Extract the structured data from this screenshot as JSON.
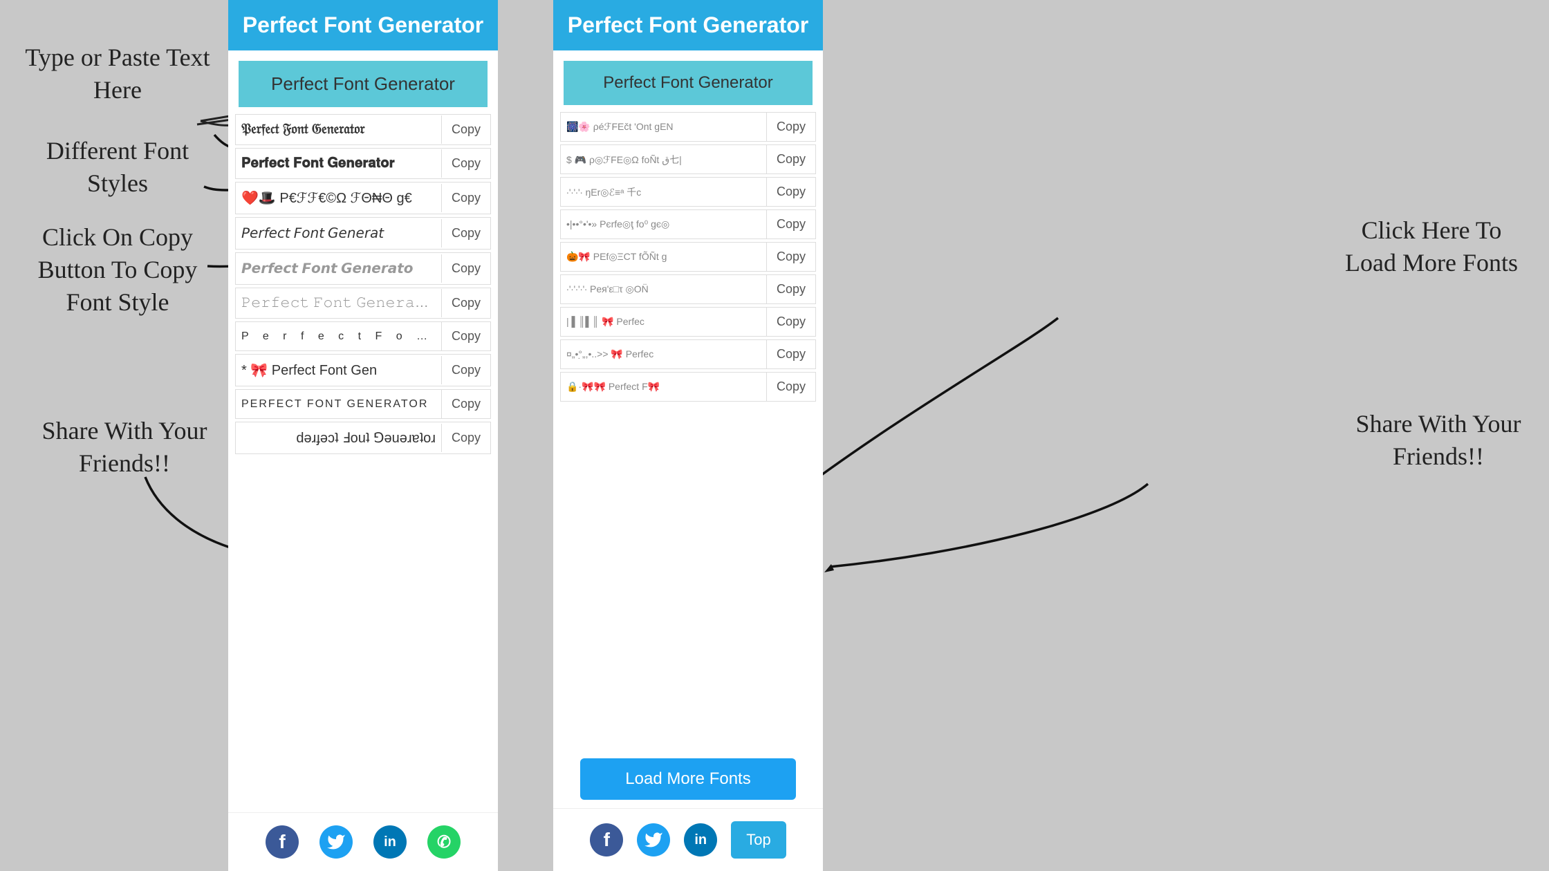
{
  "app": {
    "title": "Perfect Font Generator",
    "background_color": "#c8c8c8"
  },
  "annotations": {
    "type_paste": "Type or Paste Text\nHere",
    "different_fonts": "Different Font\nStyles",
    "click_copy": "Click On Copy\nButton To Copy\nFont Style",
    "share_left": "Share With\nYour\nFriends!!",
    "click_load": "Click Here To\nLoad More\nFonts",
    "share_right": "Share With\nYour\nFriends!!"
  },
  "left_panel": {
    "header": "Perfect Font Generator",
    "input_placeholder": "Perfect Font Generator",
    "fonts": [
      {
        "text": "𝔓𝔢𝔯𝔣𝔢𝔠𝔱 𝔉𝔬𝔫𝔱 𝔊𝔢𝔫𝔢𝔯𝔞𝔱𝔬𝔯",
        "style": "gothic",
        "copy_label": "Copy"
      },
      {
        "text": "𝐏𝐞𝐫𝐟𝐞𝐜𝐭 𝐅𝐨𝐧𝐭 𝐆𝐞𝐧𝐞𝐫𝐚𝐭𝐨𝐫",
        "style": "bold",
        "copy_label": "Copy"
      },
      {
        "text": "❤️🎩 Ρ€ℱℱ€©Ω ℱΘ₦Θ g€",
        "style": "emoji",
        "copy_label": "Copy"
      },
      {
        "text": "𝘗𝘦𝘳𝘧𝘦𝘤𝘵 𝘍𝘰𝘯𝘵 𝘎𝘦𝘯𝘦𝘳𝘢𝘵",
        "style": "italic",
        "copy_label": "Copy"
      },
      {
        "text": "𝙋𝙚𝙧𝙛𝙚𝙘𝙩 𝙁𝙤𝙣𝙩 𝙂𝙚𝙣𝙚𝙧𝙖𝙩𝙤",
        "style": "italic2",
        "copy_label": "Copy"
      },
      {
        "text": "𝙿𝚎𝚛𝚏𝚎𝚌𝚝 𝙵𝚘𝚗𝚝 𝙶𝚎𝚗𝚎𝚛𝚊𝚝𝚘𝚛",
        "style": "mono",
        "copy_label": "Copy"
      },
      {
        "text": "P e r f e c t  F o n t",
        "style": "spaced",
        "copy_label": "Copy"
      },
      {
        "text": "* 🎀 Perfect Fᴏnt Gen",
        "style": "emoji2",
        "copy_label": "Copy"
      },
      {
        "text": "PERFECT FONT GENERATOR",
        "style": "upper",
        "copy_label": "Copy"
      },
      {
        "text": "ɹoʇɐɹǝuǝ⅁ ʇuoℲ ʇɔǝɟɹǝd",
        "style": "flipped",
        "copy_label": "Copy"
      }
    ],
    "share": {
      "facebook_label": "f",
      "twitter_label": "🐦",
      "linkedin_label": "in",
      "whatsapp_label": "✆"
    }
  },
  "right_panel": {
    "header": "Perfect Font Generator",
    "input_placeholder": "Perfect Font Generator",
    "fonts": [
      {
        "text": "🎆🌸 ρéℱFEčt 'Ont gEN",
        "style": "emoji",
        "copy_label": "Copy"
      },
      {
        "text": "$ 🎮 ρ◎ℱFE◎Ω foÑt ق七|",
        "style": "emoji2",
        "copy_label": "Copy"
      },
      {
        "text": "∙'∙'∙'∙  ŋEr◎ℰ≡ᵃ 千c",
        "style": "dots",
        "copy_label": "Copy"
      },
      {
        "text": "•|••°•'•» Ρєrfe◎ţ fo⁰ gє◎",
        "style": "dots2",
        "copy_label": "Copy"
      },
      {
        "text": "🎃🎀 ΡEf◎ΞCT fÕÑt g",
        "style": "emoji3",
        "copy_label": "Copy"
      },
      {
        "text": "∙'∙'∙'∙'∙ Ρея'ε□τ ◎ON̈",
        "style": "dots3",
        "copy_label": "Copy"
      },
      {
        "text": "| ▌║▌║ 🎀 Perfec",
        "style": "barcode",
        "copy_label": "Copy"
      },
      {
        "text": "¤„•°̣„,•..>> 🎀 Perfec",
        "style": "dots4",
        "copy_label": "Copy"
      },
      {
        "text": "🔒·🎀🎀 Perfect F🎀",
        "style": "emoji4",
        "copy_label": "Copy"
      }
    ],
    "load_more_label": "Load More Fonts",
    "top_label": "Top",
    "share": {
      "facebook_label": "f",
      "twitter_label": "🐦",
      "linkedin_label": "in"
    }
  }
}
